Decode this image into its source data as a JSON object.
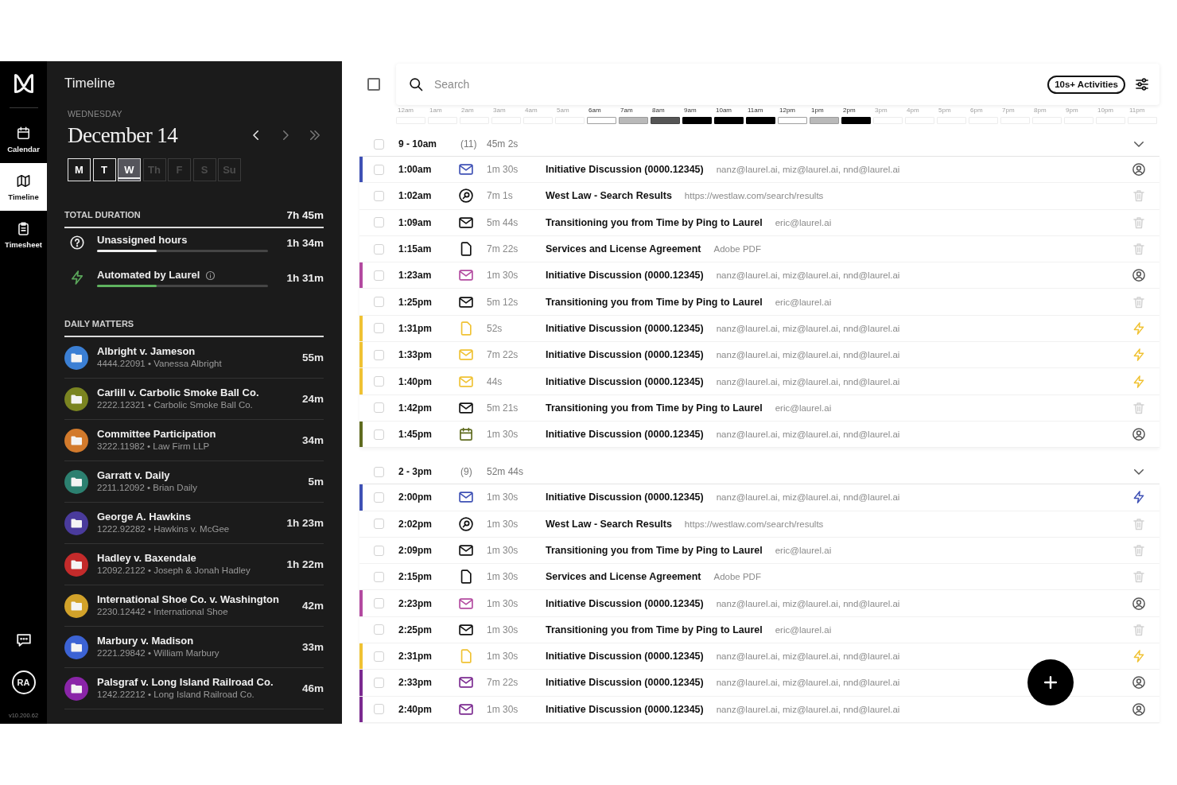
{
  "rail": {
    "nav": [
      {
        "kind": "calendar",
        "label": "Calendar",
        "selected": false
      },
      {
        "kind": "timeline",
        "label": "Timeline",
        "selected": true
      },
      {
        "kind": "timesheet",
        "label": "Timesheet",
        "selected": false
      }
    ],
    "user": {
      "initials": "RA"
    },
    "version": "v10.200.62"
  },
  "sidebar": {
    "title": "Timeline",
    "weekday": "WEDNESDAY",
    "date": "December 14",
    "nav": [
      {
        "kind": "previous",
        "disabled": false
      },
      {
        "kind": "next",
        "disabled": true
      },
      {
        "kind": "last",
        "disabled": true
      }
    ],
    "days": [
      {
        "label": "M",
        "selected": false,
        "disabled": false
      },
      {
        "label": "T",
        "selected": false,
        "disabled": false
      },
      {
        "label": "W",
        "selected": true,
        "disabled": false
      },
      {
        "label": "Th",
        "selected": false,
        "disabled": true
      },
      {
        "label": "F",
        "selected": false,
        "disabled": true
      },
      {
        "label": "S",
        "selected": false,
        "disabled": true
      },
      {
        "label": "Su",
        "selected": false,
        "disabled": true
      }
    ],
    "total": {
      "label": "TOTAL DURATION",
      "value": "7h 45m"
    },
    "breakdown": [
      {
        "kind": "unassigned",
        "label": "Unassigned hours",
        "level": 0.35,
        "value": "1h 34m"
      },
      {
        "kind": "automated",
        "label": "Automated by Laurel",
        "info": true,
        "level": 0.35,
        "value": "1h 31m"
      }
    ],
    "matters": {
      "heading": "DAILY MATTERS",
      "items": [
        {
          "title": "Albright v. Jameson",
          "subtitle": "4444.22091 • Vanessa Albright",
          "duration": "55m",
          "color": "#3b7fd4"
        },
        {
          "title": "Carlill v. Carbolic Smoke Ball Co.",
          "subtitle": "2222.12321 • Carbolic Smoke Ball Co.",
          "duration": "24m",
          "color": "#7a8421"
        },
        {
          "title": "Committee Participation",
          "subtitle": "3222.11982 • Law Firm LLP",
          "duration": "34m",
          "color": "#d27a2c"
        },
        {
          "title": "Garratt v. Daily",
          "subtitle": "2211.12092 • Brian Daily",
          "duration": "5m",
          "color": "#2c8070"
        },
        {
          "title": "George A. Hawkins",
          "subtitle": "1222.92282 • Hawkins v. McGee",
          "duration": "1h 23m",
          "color": "#4a3b9c"
        },
        {
          "title": "Hadley v. Baxendale",
          "subtitle": "12092.2122 • Joseph & Jonah Hadley",
          "duration": "1h 22m",
          "color": "#c42b2b"
        },
        {
          "title": "International Shoe Co. v. Washington",
          "subtitle": "2230.12442 • International Shoe",
          "duration": "42m",
          "color": "#d2a22a"
        },
        {
          "title": "Marbury v. Madison",
          "subtitle": "2221.29842 • William Marbury",
          "duration": "33m",
          "color": "#3c63d4"
        },
        {
          "title": "Palsgraf v. Long Island Railroad Co.",
          "subtitle": "1242.22212 • Long Island Railroad Co.",
          "duration": "46m",
          "color": "#8a25a8"
        }
      ]
    }
  },
  "main": {
    "select_all": {
      "checked": false
    },
    "search": {
      "placeholder": "Search"
    },
    "activities_button": "10s+ Activities",
    "hours": [
      {
        "label": "12am",
        "kind": "idle"
      },
      {
        "label": "1am",
        "kind": "idle"
      },
      {
        "label": "2am",
        "kind": "idle"
      },
      {
        "label": "3am",
        "kind": "idle"
      },
      {
        "label": "4am",
        "kind": "idle"
      },
      {
        "label": "5am",
        "kind": "idle"
      },
      {
        "label": "6am",
        "kind": "low"
      },
      {
        "label": "7am",
        "kind": "medium"
      },
      {
        "label": "8am",
        "kind": "high"
      },
      {
        "label": "9am",
        "kind": "full"
      },
      {
        "label": "10am",
        "kind": "full"
      },
      {
        "label": "11am",
        "kind": "full"
      },
      {
        "label": "12pm",
        "kind": "low"
      },
      {
        "label": "1pm",
        "kind": "medium"
      },
      {
        "label": "2pm",
        "kind": "full"
      },
      {
        "label": "3pm",
        "kind": "idle"
      },
      {
        "label": "4pm",
        "kind": "idle"
      },
      {
        "label": "5pm",
        "kind": "idle"
      },
      {
        "label": "6pm",
        "kind": "idle"
      },
      {
        "label": "7pm",
        "kind": "idle"
      },
      {
        "label": "8pm",
        "kind": "idle"
      },
      {
        "label": "9pm",
        "kind": "idle"
      },
      {
        "label": "10pm",
        "kind": "idle"
      },
      {
        "label": "11pm",
        "kind": "idle"
      }
    ],
    "groups": [
      {
        "label": "9 - 10am",
        "count": "(11)",
        "duration": "45m 2s",
        "checked": false,
        "expanded": true,
        "rows": [
          {
            "time": "1:00am",
            "kind": "email",
            "duration": "1m 30s",
            "title": "Initiative Discussion (0000.12345)",
            "detail": "nanz@laurel.ai, miz@laurel.ai, nnd@laurel.ai",
            "color": "#3f51b5",
            "automated": false,
            "checked": false
          },
          {
            "time": "1:02am",
            "kind": "web",
            "duration": "7m 1s",
            "title": "West Law - Search Results",
            "detail": "https://westlaw.com/search/results",
            "automated": false,
            "checked": false
          },
          {
            "time": "1:09am",
            "kind": "email",
            "duration": "5m 44s",
            "title": "Transitioning you from Time by Ping to Laurel",
            "detail": "eric@laurel.ai",
            "automated": false,
            "checked": false
          },
          {
            "time": "1:15am",
            "kind": "document",
            "duration": "7m 22s",
            "title": "Services and License Agreement",
            "detail": "Adobe PDF",
            "automated": false,
            "checked": false
          },
          {
            "time": "1:23am",
            "kind": "email",
            "duration": "1m 30s",
            "title": "Initiative Discussion (0000.12345)",
            "detail": "nanz@laurel.ai, miz@laurel.ai, nnd@laurel.ai",
            "color": "#b34aa0",
            "automated": false,
            "checked": false
          },
          {
            "time": "1:25pm",
            "kind": "email",
            "duration": "5m 12s",
            "title": "Transitioning you from Time by Ping to Laurel",
            "detail": "eric@laurel.ai",
            "automated": false,
            "checked": false
          },
          {
            "time": "1:31pm",
            "kind": "document",
            "duration": "52s",
            "title": "Initiative Discussion (0000.12345)",
            "detail": "nanz@laurel.ai, miz@laurel.ai, nnd@laurel.ai",
            "color": "#f0c233",
            "automated": true,
            "checked": false
          },
          {
            "time": "1:33pm",
            "kind": "email",
            "duration": "7m 22s",
            "title": "Initiative Discussion (0000.12345)",
            "detail": "nanz@laurel.ai, miz@laurel.ai, nnd@laurel.ai",
            "color": "#f0c233",
            "automated": true,
            "checked": false
          },
          {
            "time": "1:40pm",
            "kind": "email",
            "duration": "44s",
            "title": "Initiative Discussion (0000.12345)",
            "detail": "nanz@laurel.ai, miz@laurel.ai, nnd@laurel.ai",
            "color": "#f0c233",
            "automated": true,
            "checked": false
          },
          {
            "time": "1:42pm",
            "kind": "email",
            "duration": "5m 21s",
            "title": "Transitioning you from Time by Ping to Laurel",
            "detail": "eric@laurel.ai",
            "automated": false,
            "checked": false
          },
          {
            "time": "1:45pm",
            "kind": "event",
            "duration": "1m 30s",
            "title": "Initiative Discussion (0000.12345)",
            "detail": "nanz@laurel.ai, miz@laurel.ai, nnd@laurel.ai",
            "color": "#5f6b1f",
            "automated": false,
            "checked": false
          }
        ]
      },
      {
        "label": "2 - 3pm",
        "count": "(9)",
        "duration": "52m 44s",
        "checked": false,
        "expanded": true,
        "rows": [
          {
            "time": "2:00pm",
            "kind": "email",
            "duration": "1m 30s",
            "title": "Initiative Discussion (0000.12345)",
            "detail": "nanz@laurel.ai, miz@laurel.ai, nnd@laurel.ai",
            "color": "#3f51b5",
            "automated": true,
            "checked": false
          },
          {
            "time": "2:02pm",
            "kind": "web",
            "duration": "1m 30s",
            "title": "West Law - Search Results",
            "detail": "https://westlaw.com/search/results",
            "automated": false,
            "checked": false
          },
          {
            "time": "2:09pm",
            "kind": "email",
            "duration": "1m 30s",
            "title": "Transitioning you from Time by Ping to Laurel",
            "detail": "eric@laurel.ai",
            "automated": false,
            "checked": false
          },
          {
            "time": "2:15pm",
            "kind": "document",
            "duration": "1m 30s",
            "title": "Services and License Agreement",
            "detail": "Adobe PDF",
            "automated": false,
            "checked": false
          },
          {
            "time": "2:23pm",
            "kind": "email",
            "duration": "1m 30s",
            "title": "Initiative Discussion (0000.12345)",
            "detail": "nanz@laurel.ai, miz@laurel.ai, nnd@laurel.ai",
            "color": "#b34aa0",
            "automated": false,
            "checked": false
          },
          {
            "time": "2:25pm",
            "kind": "email",
            "duration": "1m 30s",
            "title": "Transitioning you from Time by Ping to Laurel",
            "detail": "eric@laurel.ai",
            "automated": false,
            "checked": false
          },
          {
            "time": "2:31pm",
            "kind": "document",
            "duration": "1m 30s",
            "title": "Initiative Discussion (0000.12345)",
            "detail": "nanz@laurel.ai, miz@laurel.ai, nnd@laurel.ai",
            "color": "#f0c233",
            "automated": true,
            "checked": false
          },
          {
            "time": "2:33pm",
            "kind": "email",
            "duration": "7m 22s",
            "title": "Initiative Discussion (0000.12345)",
            "detail": "nanz@laurel.ai, miz@laurel.ai, nnd@laurel.ai",
            "color": "#7b2a90",
            "automated": false,
            "checked": false
          },
          {
            "time": "2:40pm",
            "kind": "email",
            "duration": "1m 30s",
            "title": "Initiative Discussion (0000.12345)",
            "detail": "nanz@laurel.ai, miz@laurel.ai, nnd@laurel.ai",
            "color": "#7b2a90",
            "automated": false,
            "checked": false
          }
        ]
      }
    ]
  }
}
